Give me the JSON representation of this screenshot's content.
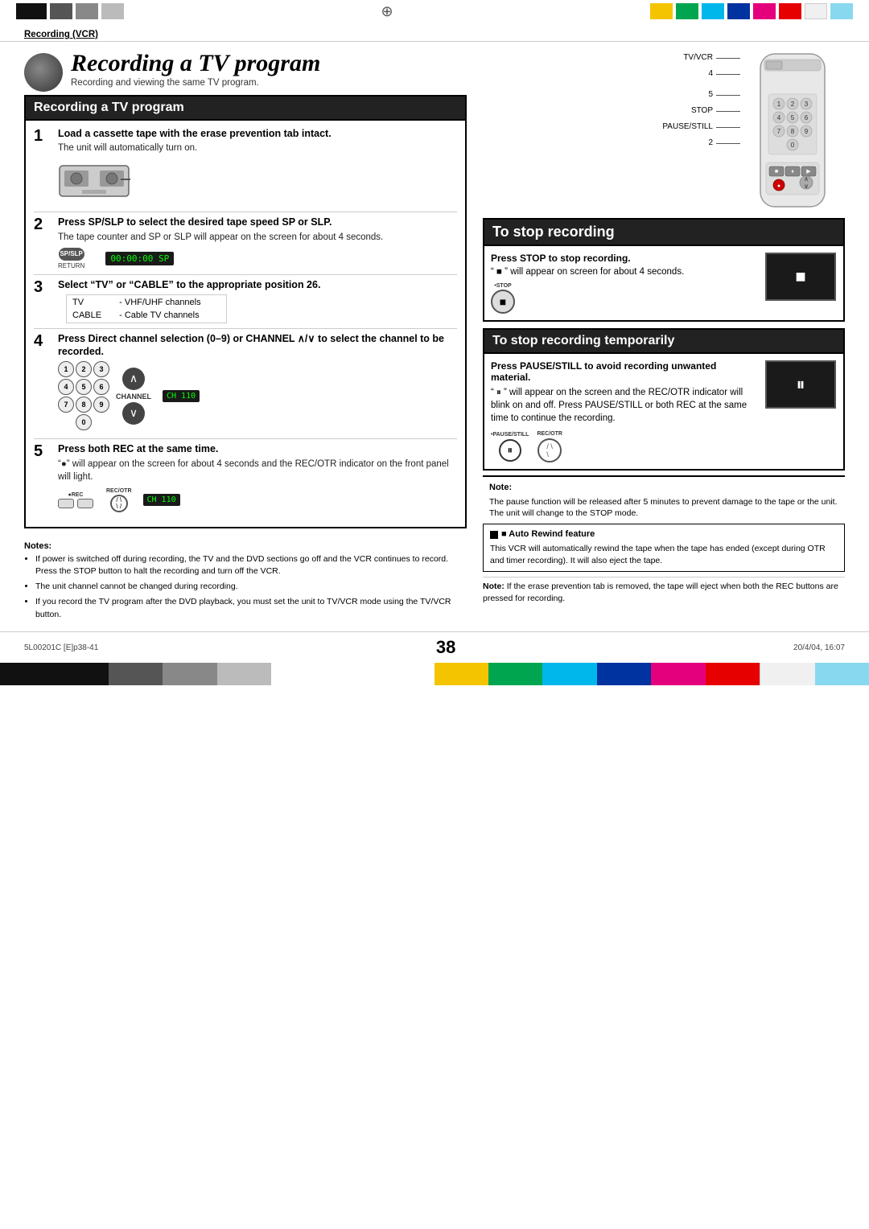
{
  "page": {
    "number": "38",
    "footer_left": "5L00201C [E]p38-41",
    "footer_center": "38",
    "footer_right": "20/4/04, 16:07"
  },
  "header": {
    "section_label": "Recording (VCR)"
  },
  "title": {
    "main": "Recording a TV program",
    "subtitle": "Recording and viewing the same TV program."
  },
  "remote_labels": {
    "tvcvr": "TV/VCR",
    "num4": "4",
    "num5": "5",
    "stop": "STOP",
    "pause_still": "PAUSE/STILL",
    "num2": "2"
  },
  "left_section": {
    "header": "Recording a TV program",
    "steps": [
      {
        "number": "1",
        "title": "Load a cassette tape with the erase prevention tab intact.",
        "desc": "The unit will automatically turn on."
      },
      {
        "number": "2",
        "title": "Press SP/SLP to select the desired tape speed SP or SLP.",
        "desc": "The tape counter and SP or SLP will appear on the screen for about 4 seconds.",
        "counter": "00:00:00 SP"
      },
      {
        "number": "3",
        "title": "Select “TV” or “CABLE” to the appropriate position 26.",
        "tv_label": "TV",
        "tv_desc": "- VHF/UHF channels",
        "cable_label": "CABLE",
        "cable_desc": "- Cable TV channels"
      },
      {
        "number": "4",
        "title": "Press Direct channel selection (0–9) or CHANNEL ∧/∨ to select the channel to be recorded.",
        "channel_display": "CH 110",
        "channel_label": "CHANNEL"
      },
      {
        "number": "5",
        "title": "Press both REC at the same time.",
        "desc": "“●” will appear on the screen for about 4 seconds and the REC/OTR indicator on the front panel will light.",
        "display": "CH 110"
      }
    ],
    "notes": {
      "title": "Notes:",
      "items": [
        "If power is switched off during recording, the TV and the DVD sections go off and the VCR continues to record. Press the STOP button to halt the recording and turn off the VCR.",
        "The unit channel cannot be changed during recording.",
        "If you record the TV program after the DVD playback, you must set the unit to TV/VCR mode using the TV/VCR button."
      ]
    }
  },
  "right_section": {
    "stop_header": "To stop recording",
    "stop_step": "Press STOP to stop recording.",
    "stop_desc": "“ ■ ” will appear on screen for about 4 seconds.",
    "pause_header": "To stop recording temporarily",
    "pause_step_title": "Press PAUSE/STILL to avoid recording unwanted material.",
    "pause_desc": "“ ⏸ ” will appear on the screen and the REC/OTR indicator will blink on and off. Press PAUSE/STILL or both REC at the same time to continue the recording.",
    "note_title": "Note:",
    "note_desc": "The pause function will be released after 5 minutes to prevent damage to the tape or the unit. The unit will change to the STOP mode.",
    "auto_rewind_title": "■ Auto Rewind feature",
    "auto_rewind_desc": "This VCR will automatically rewind the tape when the tape has ended (except during OTR and timer recording). It will also eject the tape.",
    "note2_title": "Note:",
    "note2_desc": "If the erase prevention tab is removed, the tape will eject when both the REC buttons are pressed for recording."
  }
}
